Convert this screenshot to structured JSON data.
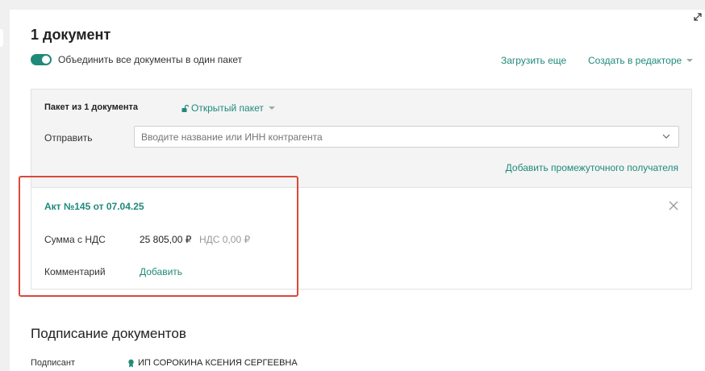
{
  "header": {
    "title": "1 документ",
    "toggle_label": "Объединить все документы в один пакет",
    "upload_more": "Загрузить еще",
    "create_in_editor": "Создать в редакторе"
  },
  "package": {
    "title": "Пакет из 1 документа",
    "open_package": "Открытый пакет",
    "send_label": "Отправить",
    "send_placeholder": "Вводите название или ИНН контрагента",
    "add_intermediate": "Добавить промежуточного получателя"
  },
  "document": {
    "title": "Акт №145 от 07.04.25",
    "sum_label": "Сумма с НДС",
    "sum_value": "25 805,00 ₽",
    "vat_value": "НДС 0,00 ₽",
    "comment_label": "Комментарий",
    "comment_add": "Добавить"
  },
  "signing": {
    "title": "Подписание документов",
    "signer_label": "Подписант",
    "signer_value": "ИП СОРОКИНА КСЕНИЯ СЕРГЕЕВНА"
  },
  "colors": {
    "accent": "#1f8a7a",
    "highlight": "#d9483b"
  }
}
